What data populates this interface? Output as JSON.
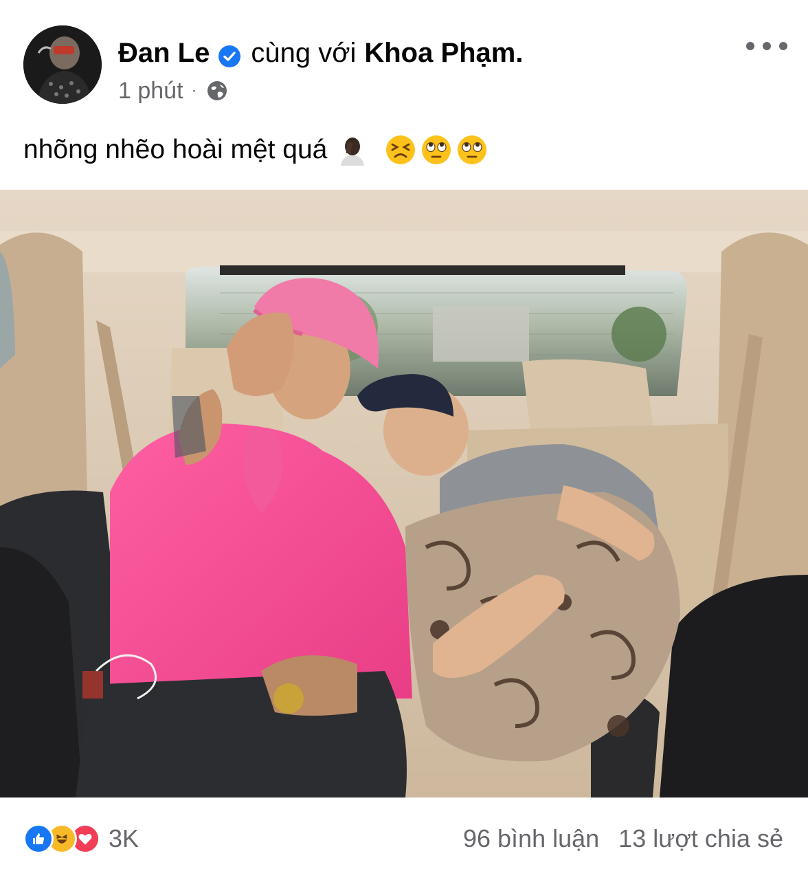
{
  "post": {
    "author": "Đan Le",
    "with_text": "cùng với",
    "tagged": "Khoa Phạm.",
    "time": "1 phút",
    "separator": "·",
    "privacy_icon": "globe-icon",
    "verified_icon": "verified-badge-icon",
    "more_icon": "more-options-icon",
    "caption": "nhõng nhẽo hoài mệt quá",
    "caption_emojis": [
      "person-facepalming-emoji",
      "tired-face-emoji",
      "face-with-rolling-eyes-emoji",
      "face-with-rolling-eyes-emoji"
    ]
  },
  "footer": {
    "reaction_icons": [
      "like-reaction-icon",
      "haha-reaction-icon",
      "love-reaction-icon"
    ],
    "reaction_count": "3K",
    "comments": "96 bình luận",
    "shares": "13 lượt chia sẻ"
  },
  "colors": {
    "text_primary": "#050505",
    "text_secondary": "#65676b",
    "verified_blue": "#1877f2",
    "like_blue": "#1877f2",
    "haha_yellow": "#f7b928",
    "love_red": "#f33e58"
  }
}
